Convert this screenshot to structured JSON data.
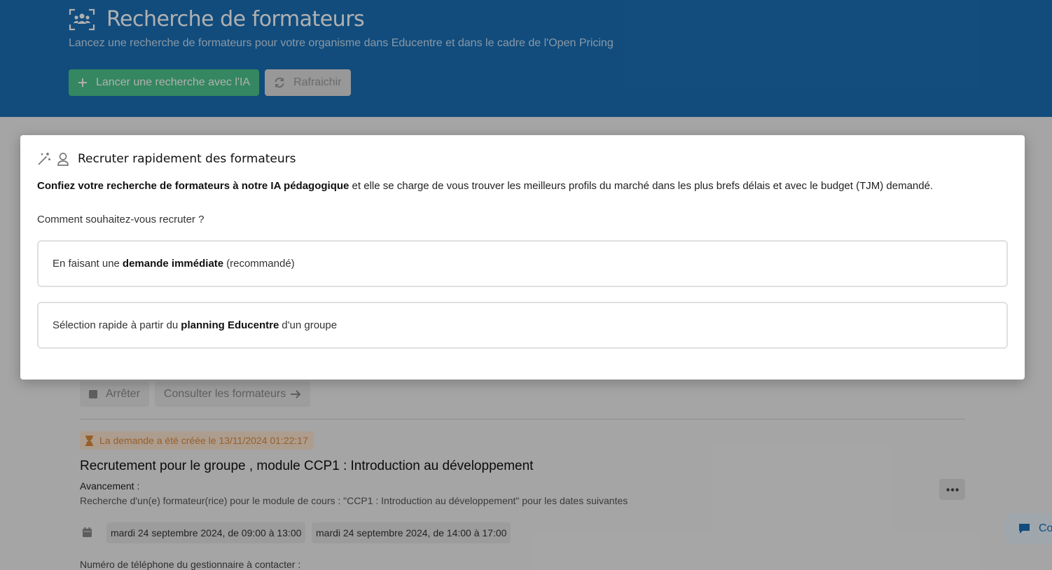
{
  "header": {
    "title": "Recherche de formateurs",
    "subtitle": "Lancez une recherche de formateurs pour votre organisme dans Educentre et dans le cadre de l'Open Pricing",
    "launch_button": "Lancer une recherche avec l'IA",
    "refresh_button": "Rafraichir"
  },
  "background": {
    "stop_button": "Arrêter",
    "view_trainers_button": "Consulter les formateurs",
    "created_badge": "La demande a été créée le 13/11/2024 01:22:17",
    "request_title": "Recrutement pour le groupe , module CCP1 : Introduction au développement",
    "progress_label": "Avancement :",
    "progress_text": "Recherche d'un(e) formateur(rice) pour le module de cours : \"CCP1 : Introduction au développement\" pour les dates suivantes",
    "dates": [
      "mardi 24 septembre 2024, de 09:00 à 13:00",
      "mardi 24 septembre 2024, de 14:00 à 17:00"
    ],
    "phone_label": "Numéro de téléphone du gestionnaire à contacter :",
    "chat_label": "Co"
  },
  "modal": {
    "title": "Recruter rapidement des formateurs",
    "description_bold": "Confiez votre recherche de formateurs à notre IA pédagogique",
    "description_rest": "et elle se charge de vous trouver les meilleurs profils du marché dans les plus brefs délais et avec le budget (TJM) demandé.",
    "question": "Comment souhaitez-vous recruter ?",
    "options": [
      {
        "prefix": "En faisant une",
        "bold": "demande immédiate",
        "suffix": "(recommandé)"
      },
      {
        "prefix": "Sélection rapide à partir du",
        "bold": "planning Educentre",
        "suffix": "d'un groupe"
      }
    ]
  },
  "colors": {
    "header_bg": "#1a6fb5",
    "accent_green": "#4cc48c",
    "warning_orange": "#d98a3e"
  },
  "icons": {
    "header": "users-scan-icon",
    "launch": "plus-icon",
    "refresh": "refresh-icon",
    "stop": "stop-square-icon",
    "view": "arrow-right-icon",
    "created": "hourglass-icon",
    "more": "ellipsis-icon",
    "calendar": "calendar-icon",
    "chat": "chat-bubble-icon",
    "modal_magic": "magic-wand-icon",
    "modal_award": "award-user-icon"
  }
}
